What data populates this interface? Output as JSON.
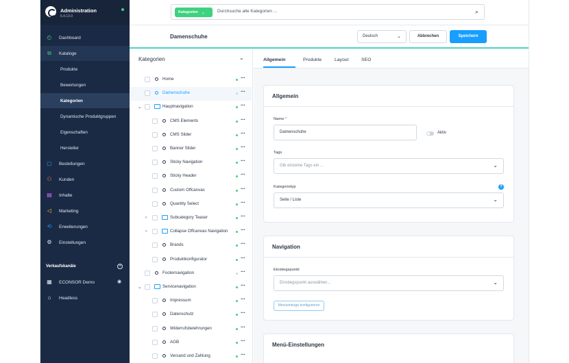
{
  "brand": {
    "title": "Administration",
    "version": "6.4.13.0"
  },
  "sidebar": {
    "items": [
      {
        "label": "Dashboard",
        "icon": "dashboard-icon"
      },
      {
        "label": "Kataloge",
        "icon": "catalog-icon"
      },
      {
        "label": "Bestellungen",
        "icon": "orders-icon"
      },
      {
        "label": "Kunden",
        "icon": "customers-icon"
      },
      {
        "label": "Inhalte",
        "icon": "content-icon"
      },
      {
        "label": "Marketing",
        "icon": "marketing-icon"
      },
      {
        "label": "Erweiterungen",
        "icon": "extensions-icon"
      },
      {
        "label": "Einstellungen",
        "icon": "settings-icon"
      }
    ],
    "sub_items": [
      "Produkte",
      "Bewertungen",
      "Kategorien",
      "Dynamische Produktgruppen",
      "Eigenschaften",
      "Hersteller"
    ],
    "sales_channels_title": "Verkaufskanäle",
    "sales_channels": [
      "ECONSOR Demo",
      "Headless"
    ]
  },
  "search": {
    "tag_label": "Kategorien",
    "placeholder": "Durchsuche alle Kategorien ..."
  },
  "header": {
    "title": "Damenschuhe",
    "language": "Deutsch",
    "cancel_label": "Abbrechen",
    "save_label": "Speichern"
  },
  "tree": {
    "title": "Kategorien",
    "rows": [
      {
        "label": "Home",
        "status": "active"
      },
      {
        "label": "Damenschuhe",
        "status": "inactive"
      },
      {
        "label": "Hauptnavigation",
        "status": "active"
      },
      {
        "label": "CMS Elements",
        "status": "active"
      },
      {
        "label": "CMS Slider",
        "status": "active"
      },
      {
        "label": "Banner Slider",
        "status": "active"
      },
      {
        "label": "Sticky Navigation",
        "status": "active"
      },
      {
        "label": "Sticky Header",
        "status": "active"
      },
      {
        "label": "Custom Offcanvas",
        "status": "active"
      },
      {
        "label": "Quantity Select",
        "status": "active"
      },
      {
        "label": "Subcategory Teaser",
        "status": "active"
      },
      {
        "label": "Collapse Offcanvas Navigation",
        "status": "active"
      },
      {
        "label": "Brands",
        "status": "active"
      },
      {
        "label": "Produktkonfigurator",
        "status": "active"
      },
      {
        "label": "Footernavigation",
        "status": "inactive"
      },
      {
        "label": "Servicenavigation",
        "status": "active"
      },
      {
        "label": "Impressum",
        "status": "active"
      },
      {
        "label": "Datenschutz",
        "status": "active"
      },
      {
        "label": "Widerrufsbelehrungen",
        "status": "active"
      },
      {
        "label": "AGB",
        "status": "active"
      },
      {
        "label": "Versand und Zahlung",
        "status": "active"
      }
    ]
  },
  "tabs": [
    "Allgemein",
    "Produkte",
    "Layout",
    "SEO"
  ],
  "general": {
    "title": "Allgemein",
    "name_label": "Name",
    "name_required": "*",
    "name_value": "Damenschuhe",
    "active_label": "Aktiv",
    "tags_label": "Tags",
    "tags_placeholder": "Gib einzelne Tags ein ...",
    "type_label": "Kategorietyp",
    "type_value": "Seite / Liste"
  },
  "navigation": {
    "title": "Navigation",
    "entry_label": "Einstiegspunkt",
    "entry_placeholder": "Einstiegspunkt auswählen...",
    "configure_label": "Menüeinträge konfigurieren"
  },
  "menu_settings": {
    "title": "Menü-Einstellungen"
  },
  "colors": {
    "sidebar": "#1b2a44",
    "accent": "#189eff",
    "status_active": "#3ed17f",
    "search_tag": "#3ed17f"
  }
}
